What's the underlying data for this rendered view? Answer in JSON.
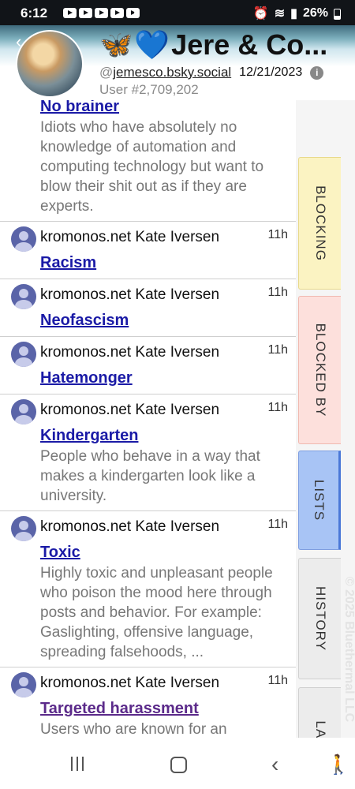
{
  "status_bar": {
    "time": "6:12",
    "battery": "26%",
    "notification_icons": [
      "youtube-icon",
      "youtube-icon",
      "youtube-icon",
      "youtube-icon",
      "youtube-icon"
    ]
  },
  "header": {
    "title": "Jere & Co...",
    "emoji": [
      "🦋",
      "💙"
    ],
    "handle_prefix": "@",
    "handle": "jemesco.bsky.social",
    "date": "12/21/2023",
    "user_number": "User #2,709,202",
    "info_icon": "i"
  },
  "entries": [
    {
      "author": "",
      "time": "",
      "name": "No brainer",
      "visited": false,
      "description": "Idiots who have absolutely no knowledge of automation and computing technology but want to blow their shit out as if they are experts."
    },
    {
      "author": "kromonos.net Kate Iversen",
      "time": "11h",
      "name": "Racism",
      "visited": false,
      "description": ""
    },
    {
      "author": "kromonos.net Kate Iversen",
      "time": "11h",
      "name": "Neofascism",
      "visited": false,
      "description": ""
    },
    {
      "author": "kromonos.net Kate Iversen",
      "time": "11h",
      "name": "Hatemonger",
      "visited": false,
      "description": ""
    },
    {
      "author": "kromonos.net Kate Iversen",
      "time": "11h",
      "name": "Kindergarten",
      "visited": false,
      "description": "People who behave in a way that makes a kindergarten look like a university."
    },
    {
      "author": "kromonos.net Kate Iversen",
      "time": "11h",
      "name": "Toxic",
      "visited": false,
      "description": "Highly toxic and unpleasant people who poison the mood here through posts and behavior. For example: Gaslighting, offensive language, spreading falsehoods, ..."
    },
    {
      "author": "kromonos.net Kate Iversen",
      "time": "11h",
      "name": "Targeted harassment",
      "visited": true,
      "description": "Users who are known for an unhealthy obsession with..."
    }
  ],
  "tabs": {
    "blocking": "BLOCKING",
    "blocked_by": "BLOCKED BY",
    "lists": "LISTS",
    "history": "HISTORY",
    "lab": "LAB"
  },
  "copyright": "© 2025 Bluethermal LLC",
  "colors": {
    "link": "#1a1aa6",
    "visited_link": "#5b2a8a",
    "lists_tab": "#a8c4f5",
    "blocking_tab": "#fbf3c2",
    "blocked_by_tab": "#fde0dc"
  }
}
